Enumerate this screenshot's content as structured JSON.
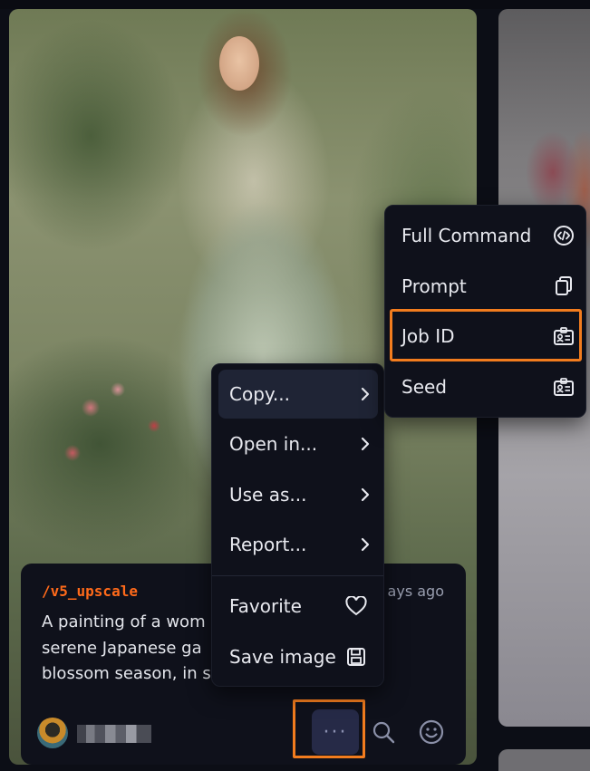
{
  "caption": {
    "command": "/v5_upscale",
    "time": "ays ago",
    "prompt": "A painting of a wom                     in a\nserene Japanese ga\nblossom season, in                       s..."
  },
  "context_menu": {
    "items": [
      {
        "label": "Copy...",
        "icon": "chevron-right-icon"
      },
      {
        "label": "Open in...",
        "icon": "chevron-right-icon"
      },
      {
        "label": "Use as...",
        "icon": "chevron-right-icon"
      },
      {
        "label": "Report...",
        "icon": "chevron-right-icon"
      },
      {
        "label": "Favorite",
        "icon": "heart-icon"
      },
      {
        "label": "Save image",
        "icon": "floppy-icon"
      }
    ]
  },
  "copy_submenu": {
    "items": [
      {
        "label": "Full Command",
        "icon": "code-icon"
      },
      {
        "label": "Prompt",
        "icon": "copy-icon"
      },
      {
        "label": "Job ID",
        "icon": "id-card-icon"
      },
      {
        "label": "Seed",
        "icon": "id-card-icon"
      }
    ]
  },
  "colors": {
    "accent_orange": "#f27c1e",
    "command_orange": "#ff6a1a",
    "menu_bg": "#0f111b"
  }
}
